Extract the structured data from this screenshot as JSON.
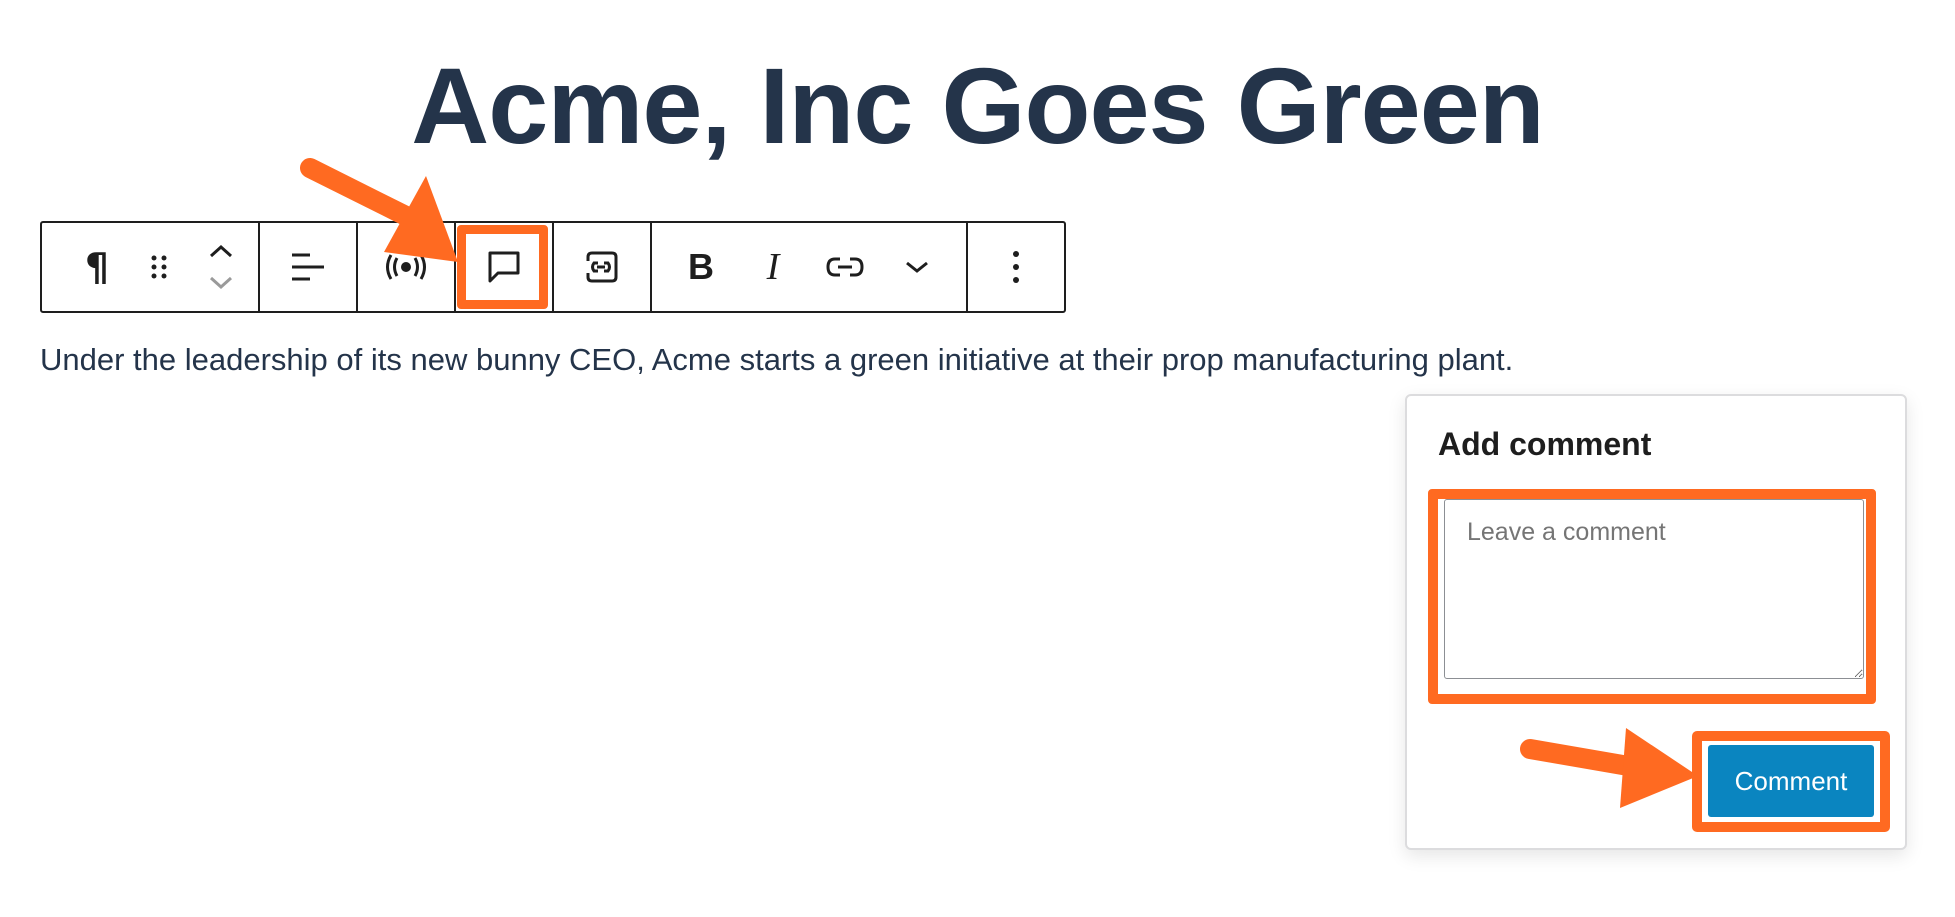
{
  "post": {
    "title": "Acme, Inc Goes Green",
    "paragraph": "Under the leadership of its new bunny CEO, Acme starts a green initiative at their prop manufacturing plant."
  },
  "toolbar": {
    "paragraph_glyph": "¶",
    "bold_glyph": "B",
    "italic_glyph": "I",
    "icons": [
      "paragraph-icon",
      "drag-handle-icon",
      "move-up-down-icon",
      "align-left-icon",
      "broadcast-icon",
      "comment-icon",
      "link-embed-icon",
      "bold-icon",
      "italic-icon",
      "link-icon",
      "chevron-down-icon",
      "more-options-icon"
    ]
  },
  "comment_panel": {
    "heading": "Add comment",
    "textarea_placeholder": "Leave a comment",
    "textarea_value": "",
    "submit_label": "Comment"
  },
  "colors": {
    "title": "#24344a",
    "highlight": "#ff6a21",
    "button": "#0a85c0"
  }
}
